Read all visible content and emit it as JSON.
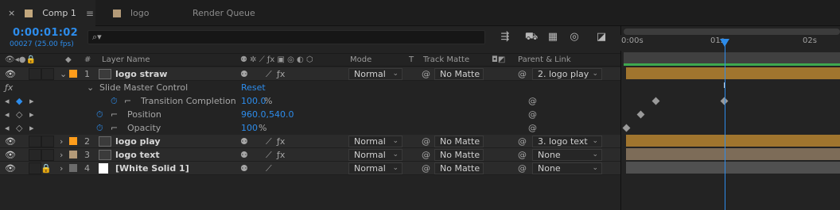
{
  "tabs": [
    {
      "close": "×",
      "label": "Comp 1",
      "menu": "≡",
      "color": "#c2a77d"
    },
    {
      "label": "logo",
      "color": "#b39a78"
    },
    {
      "label": "Render Queue"
    }
  ],
  "timecode": "0:00:01:02",
  "frames": "00027 (25.00 fps)",
  "search": {
    "placeholder": "",
    "icon": "search-icon"
  },
  "columns": {
    "layer_name": "Layer Name",
    "mode": "Mode",
    "t": "T",
    "track_matte": "Track Matte",
    "parent": "Parent & Link",
    "num": "#"
  },
  "layers": [
    {
      "num": "1",
      "name": "logo straw",
      "label_color": "#ff9d1b",
      "mode": "Normal",
      "matte": "No Matte",
      "parent": "2. logo play",
      "expanded": true
    },
    {
      "num": "2",
      "name": "logo play",
      "label_color": "#ff9d1b",
      "mode": "Normal",
      "matte": "No Matte",
      "parent": "3. logo text"
    },
    {
      "num": "3",
      "name": "logo text",
      "label_color": "#b39a78",
      "mode": "Normal",
      "matte": "No Matte",
      "parent": "None"
    },
    {
      "num": "4",
      "name": "[White Solid 1]",
      "label_color": "#6c6c6c",
      "mode": "Normal",
      "matte": "No Matte",
      "parent": "None"
    }
  ],
  "effect": {
    "name": "Slide Master Control",
    "reset": "Reset",
    "property": "Transition Completion",
    "value": "100.0",
    "unit": "%"
  },
  "position": {
    "name": "Position",
    "value": "960.0,540.0"
  },
  "opacity": {
    "name": "Opacity",
    "value": "100",
    "unit": "%"
  },
  "ruler": {
    "ticks": [
      "0:00s",
      "01s",
      "02s"
    ]
  },
  "colors": {
    "accent": "#2d8ceb",
    "layer_bar_orange": "#a0752e",
    "layer_bar_tan": "#7d6c58",
    "layer_bar_gray": "#505050"
  }
}
